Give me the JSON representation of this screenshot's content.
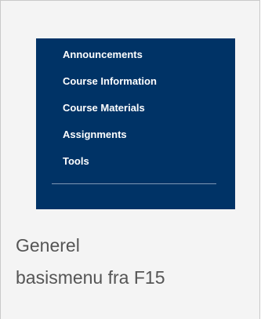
{
  "thumbnail": {
    "menu_items": [
      "Announcements",
      "Course Information",
      "Course Materials",
      "Assignments",
      "Tools"
    ],
    "background_color": "#003366",
    "text_color": "#ffffff"
  },
  "caption": {
    "line1": "Generel",
    "line2": "basismenu fra F15"
  }
}
